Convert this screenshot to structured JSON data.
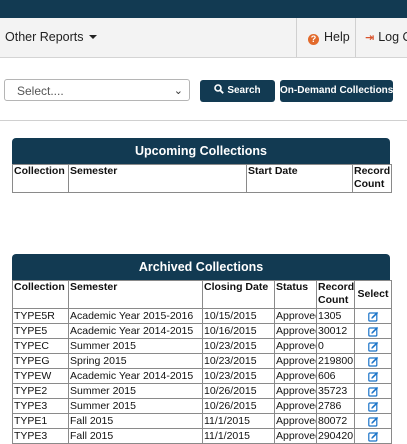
{
  "nav": {
    "reports_label": "Other Reports",
    "help_label": "Help",
    "logout_label": "Log Out"
  },
  "toolbar": {
    "select_value": "Select....",
    "search_label": "Search",
    "ondemand_label": "On-Demand Collections"
  },
  "upcoming": {
    "title": "Upcoming Collections",
    "columns": [
      "Collection",
      "Semester",
      "Start Date",
      "Record Count"
    ]
  },
  "archived": {
    "title": "Archived Collections",
    "columns": [
      "Collection",
      "Semester",
      "Closing Date",
      "Status",
      "Record Count",
      "Select"
    ],
    "rows": [
      [
        "TYPE5R",
        "Academic Year 2015-2016",
        "10/15/2015",
        "Approved",
        "1305"
      ],
      [
        "TYPE5",
        "Academic Year 2014-2015",
        "10/16/2015",
        "Approved",
        "30012"
      ],
      [
        "TYPEC",
        "Summer 2015",
        "10/23/2015",
        "Approved",
        "0"
      ],
      [
        "TYPEG",
        "Spring 2015",
        "10/23/2015",
        "Approved",
        "219800"
      ],
      [
        "TYPEW",
        "Academic Year 2014-2015",
        "10/23/2015",
        "Approved",
        "606"
      ],
      [
        "TYPE2",
        "Summer 2015",
        "10/26/2015",
        "Approved",
        "35723"
      ],
      [
        "TYPE3",
        "Summer 2015",
        "10/26/2015",
        "Approved",
        "2786"
      ],
      [
        "TYPE1",
        "Fall 2015",
        "11/1/2015",
        "Approved",
        "80072"
      ],
      [
        "TYPE3",
        "Fall 2015",
        "11/1/2015",
        "Approved",
        "290420"
      ]
    ]
  },
  "colors": {
    "primary": "#123a52",
    "help_icon": "#e26a2c",
    "edit_icon": "#1a73c8"
  },
  "icons": {
    "help": "question-circle-icon",
    "logout": "sign-out-icon",
    "search": "search-icon",
    "edit": "edit-icon"
  }
}
